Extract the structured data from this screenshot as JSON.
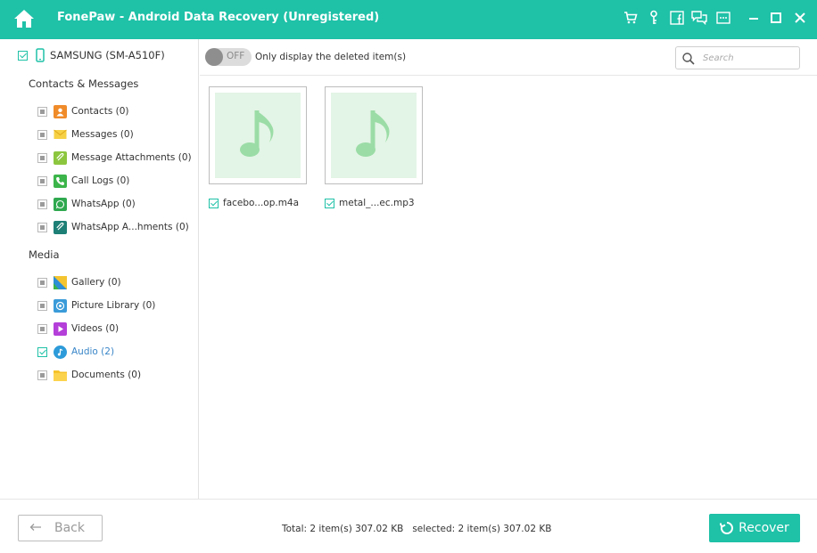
{
  "titlebar": {
    "title": "FonePaw - Android Data Recovery (Unregistered)",
    "icons": [
      "home-icon",
      "cart-icon",
      "key-icon",
      "facebook-icon",
      "chat-icon",
      "menu-icon",
      "minimize-icon",
      "maximize-icon",
      "close-icon"
    ]
  },
  "sidebar": {
    "device": "SAMSUNG (SM-A510F)",
    "sections": [
      {
        "title": "Contacts & Messages",
        "items": [
          {
            "label": "Contacts (0)",
            "icon": "contacts-icon",
            "state": "partial"
          },
          {
            "label": "Messages (0)",
            "icon": "messages-icon",
            "state": "partial"
          },
          {
            "label": "Message Attachments (0)",
            "icon": "attachment-icon",
            "state": "partial"
          },
          {
            "label": "Call Logs (0)",
            "icon": "phone-icon",
            "state": "partial"
          },
          {
            "label": "WhatsApp (0)",
            "icon": "whatsapp-icon",
            "state": "partial"
          },
          {
            "label": "WhatsApp A...hments (0)",
            "icon": "whatsapp-attachment-icon",
            "state": "partial"
          }
        ]
      },
      {
        "title": "Media",
        "items": [
          {
            "label": "Gallery (0)",
            "icon": "gallery-icon",
            "state": "partial"
          },
          {
            "label": "Picture Library (0)",
            "icon": "picture-library-icon",
            "state": "partial"
          },
          {
            "label": "Videos (0)",
            "icon": "video-icon",
            "state": "partial"
          },
          {
            "label": "Audio (2)",
            "icon": "audio-icon",
            "state": "checked"
          },
          {
            "label": "Documents (0)",
            "icon": "folder-icon",
            "state": "partial"
          }
        ]
      }
    ]
  },
  "toolbar": {
    "toggle_state": "OFF",
    "toggle_label": "Only display the deleted item(s)",
    "search_placeholder": "Search"
  },
  "files": [
    {
      "name": "facebo...op.m4a",
      "checked": true,
      "icon": "music-note-icon"
    },
    {
      "name": "metal_...ec.mp3",
      "checked": true,
      "icon": "music-note-icon"
    }
  ],
  "footer": {
    "back_label": "Back",
    "status": "Total: 2 item(s) 307.02 KB   selected: 2 item(s) 307.02 KB",
    "recover_label": "Recover"
  },
  "colors": {
    "accent": "#1fc1a7",
    "active_text": "#3a86c8",
    "thumb_bg": "#e3f5e6"
  }
}
